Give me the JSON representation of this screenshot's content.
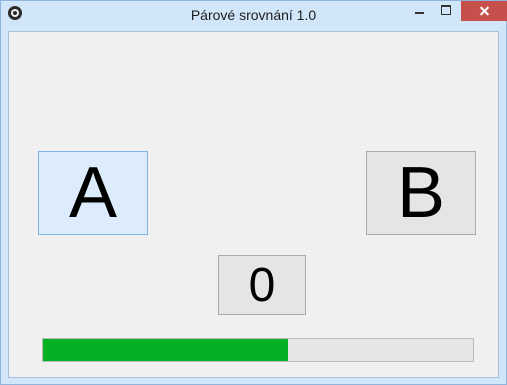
{
  "window": {
    "title": "Párové srovnání 1.0",
    "app_icon": "app-icon",
    "controls": {
      "minimize_icon": "minimize-icon",
      "maximize_icon": "maximize-icon",
      "close_icon": "close-icon",
      "close_color": "#c7504c"
    }
  },
  "main": {
    "option_a_label": "A",
    "option_b_label": "B",
    "counter_value": "0",
    "progress": {
      "fraction": 0.57,
      "color": "#06b025"
    }
  }
}
